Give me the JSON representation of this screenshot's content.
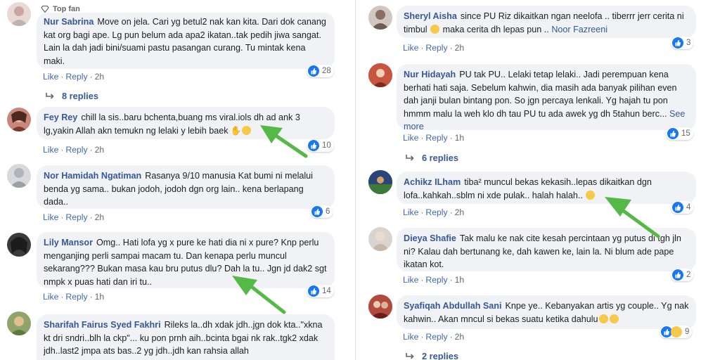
{
  "left": {
    "top_fan_label": "Top fan",
    "comments": [
      {
        "name": "Nur Sabrina",
        "text": "Move on jela. Cari yg betul2 nak kan kita. Dari dok canang kat org bagi ape. Lg pun belum ada apa2 ikatan..tak pedih jiwa sangat. Lain la dah jadi bini/suami pastu pasangan curang. Tu mintak kena maki.",
        "like": "Like",
        "reply": "Reply",
        "time": "2h",
        "reactions": "28",
        "replies": "8 replies"
      },
      {
        "name": "Fey Rey",
        "text": "chill la sis..baru bchenta,buang ms viral.iols dh ad ank 3 lg,yakin Allah akn temukn ng lelaki y lebih baek",
        "like": "Like",
        "reply": "Reply",
        "time": "2h",
        "reactions": "10"
      },
      {
        "name": "Nor Hamidah Ngatiman",
        "text": "Rasanya 9/10 manusia Kat bumi ni melalui benda yg sama.. bukan jodoh, jodoh dgn org lain.. kena berlapang dada..",
        "like": "Like",
        "reply": "Reply",
        "time": "2h",
        "reactions": "6"
      },
      {
        "name": "Lily Mansor",
        "text": "Omg.. Hati lofa yg x pure ke hati dia ni x pure? Knp perlu menganjing perli sampai macam tu. Dan kenapa perlu muncul sekarang??? Bukan masa kau bru putus dlu? Dah la tu.. Jgn jd dak2 sgt nmpk x puas hati dan iri tu..",
        "like": "Like",
        "reply": "Reply",
        "time": "1h",
        "reactions": "14"
      },
      {
        "name": "Sharifah Fairus Syed Fakhri",
        "text": "Rileks la..dh xdak jdh..jgn dok kta..\"xkna kt dri sndri..blh la ckp\"... ku pon prnh aih..bcinta bgai nk rak..tgk2 xdak jdh..last2 jmpa ats bas..2 yg jdh..jdh kan rahsia allah"
      }
    ]
  },
  "right": {
    "comments": [
      {
        "name": "Sheryl Aisha",
        "text_a": "since PU Riz dikaitkan ngan neelofa .. tiberrr jerr cerita ni timbul",
        "text_b": "maka cerita dh lepas pun ..",
        "mention": "Noor Fazreeni",
        "like": "Like",
        "reply": "Reply",
        "time": "2h",
        "reactions": "3"
      },
      {
        "name": "Nur Hidayah",
        "text": "PU tak PU.. Lelaki tetap lelaki.. Jadi perempuan kena berhati hati saja. Sebelum kahwin, dia masih ada banyak pilihan even dah janji bulan bintang pon. So jgn percaya lenkali. Yg hajah tu pon hmmm malu la weh klo dh tau PU tu ada awek yg dh 5tahun berc...",
        "see_more": "See more",
        "like": "Like",
        "reply": "Reply",
        "time": "1h",
        "reactions": "15",
        "replies": "6 replies"
      },
      {
        "name": "Achikz ILham",
        "text": "tiba² muncul bekas kekasih..lepas dikaitkan dgn lofa..kahkah..sblm ni xde pulak.. halah halah..",
        "like": "Like",
        "reply": "Reply",
        "time": "2h",
        "reactions": "4"
      },
      {
        "name": "Dieya Shafie",
        "text": "Tak malu ke nak cite kesah percintaan yg putus di tgh jln ni? Kalau dah bertunang ke, dah kawen ke, lain la. Ni blum ade pape ikatan kot.",
        "like": "Like",
        "reply": "Reply",
        "time": "1h",
        "reactions": "2"
      },
      {
        "name": "Syafiqah Abdullah Sani",
        "text": "Knpe ye.. Kebanyakan artis yg couple.. Yg nak kahwin.. Akan mncul si bekas suatu ketika dahulu",
        "like": "Like",
        "reply": "Reply",
        "time": "2h",
        "reactions": "9",
        "replies": "2 replies"
      }
    ]
  },
  "colors": {
    "name": "#365899",
    "bubble": "#f0f2f5",
    "like_blue": "#1877f2",
    "arrow_green": "#55b947"
  }
}
